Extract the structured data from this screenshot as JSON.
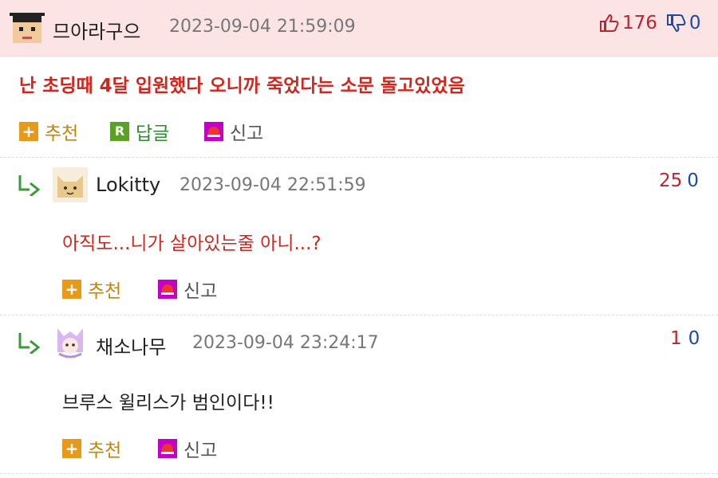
{
  "post": {
    "nick": "므아라구으",
    "date": "2023-09-04 21:59:09",
    "up_count": "176",
    "down_count": "0",
    "content": "난 초딩때 4달 입원했다 오니까 죽었다는 소문 돌고있었음",
    "recommend_label": "추천",
    "reply_label": "답글",
    "report_label": "신고",
    "reply_icon_text": "R"
  },
  "comments": [
    {
      "nick": "Lokitty",
      "date": "2023-09-04 22:51:59",
      "up_count": "25",
      "down_count": "0",
      "content": "아직도...니가 살아있는줄 아니...?",
      "recommend_label": "추천",
      "report_label": "신고"
    },
    {
      "nick": "채소나무",
      "date": "2023-09-04 23:24:17",
      "up_count": "1",
      "down_count": "0",
      "content": "브루스 윌리스가 범인이다!!",
      "recommend_label": "추천",
      "report_label": "신고"
    }
  ],
  "colors": {
    "header_bg": "#fde4e4",
    "red_text": "#d0261e",
    "up": "#c0232b",
    "down": "#1a4ba5"
  },
  "icons": [
    "thumbs-up-icon",
    "thumbs-down-icon",
    "plus-icon",
    "reply-icon",
    "report-siren-icon",
    "reply-arrow-icon"
  ]
}
